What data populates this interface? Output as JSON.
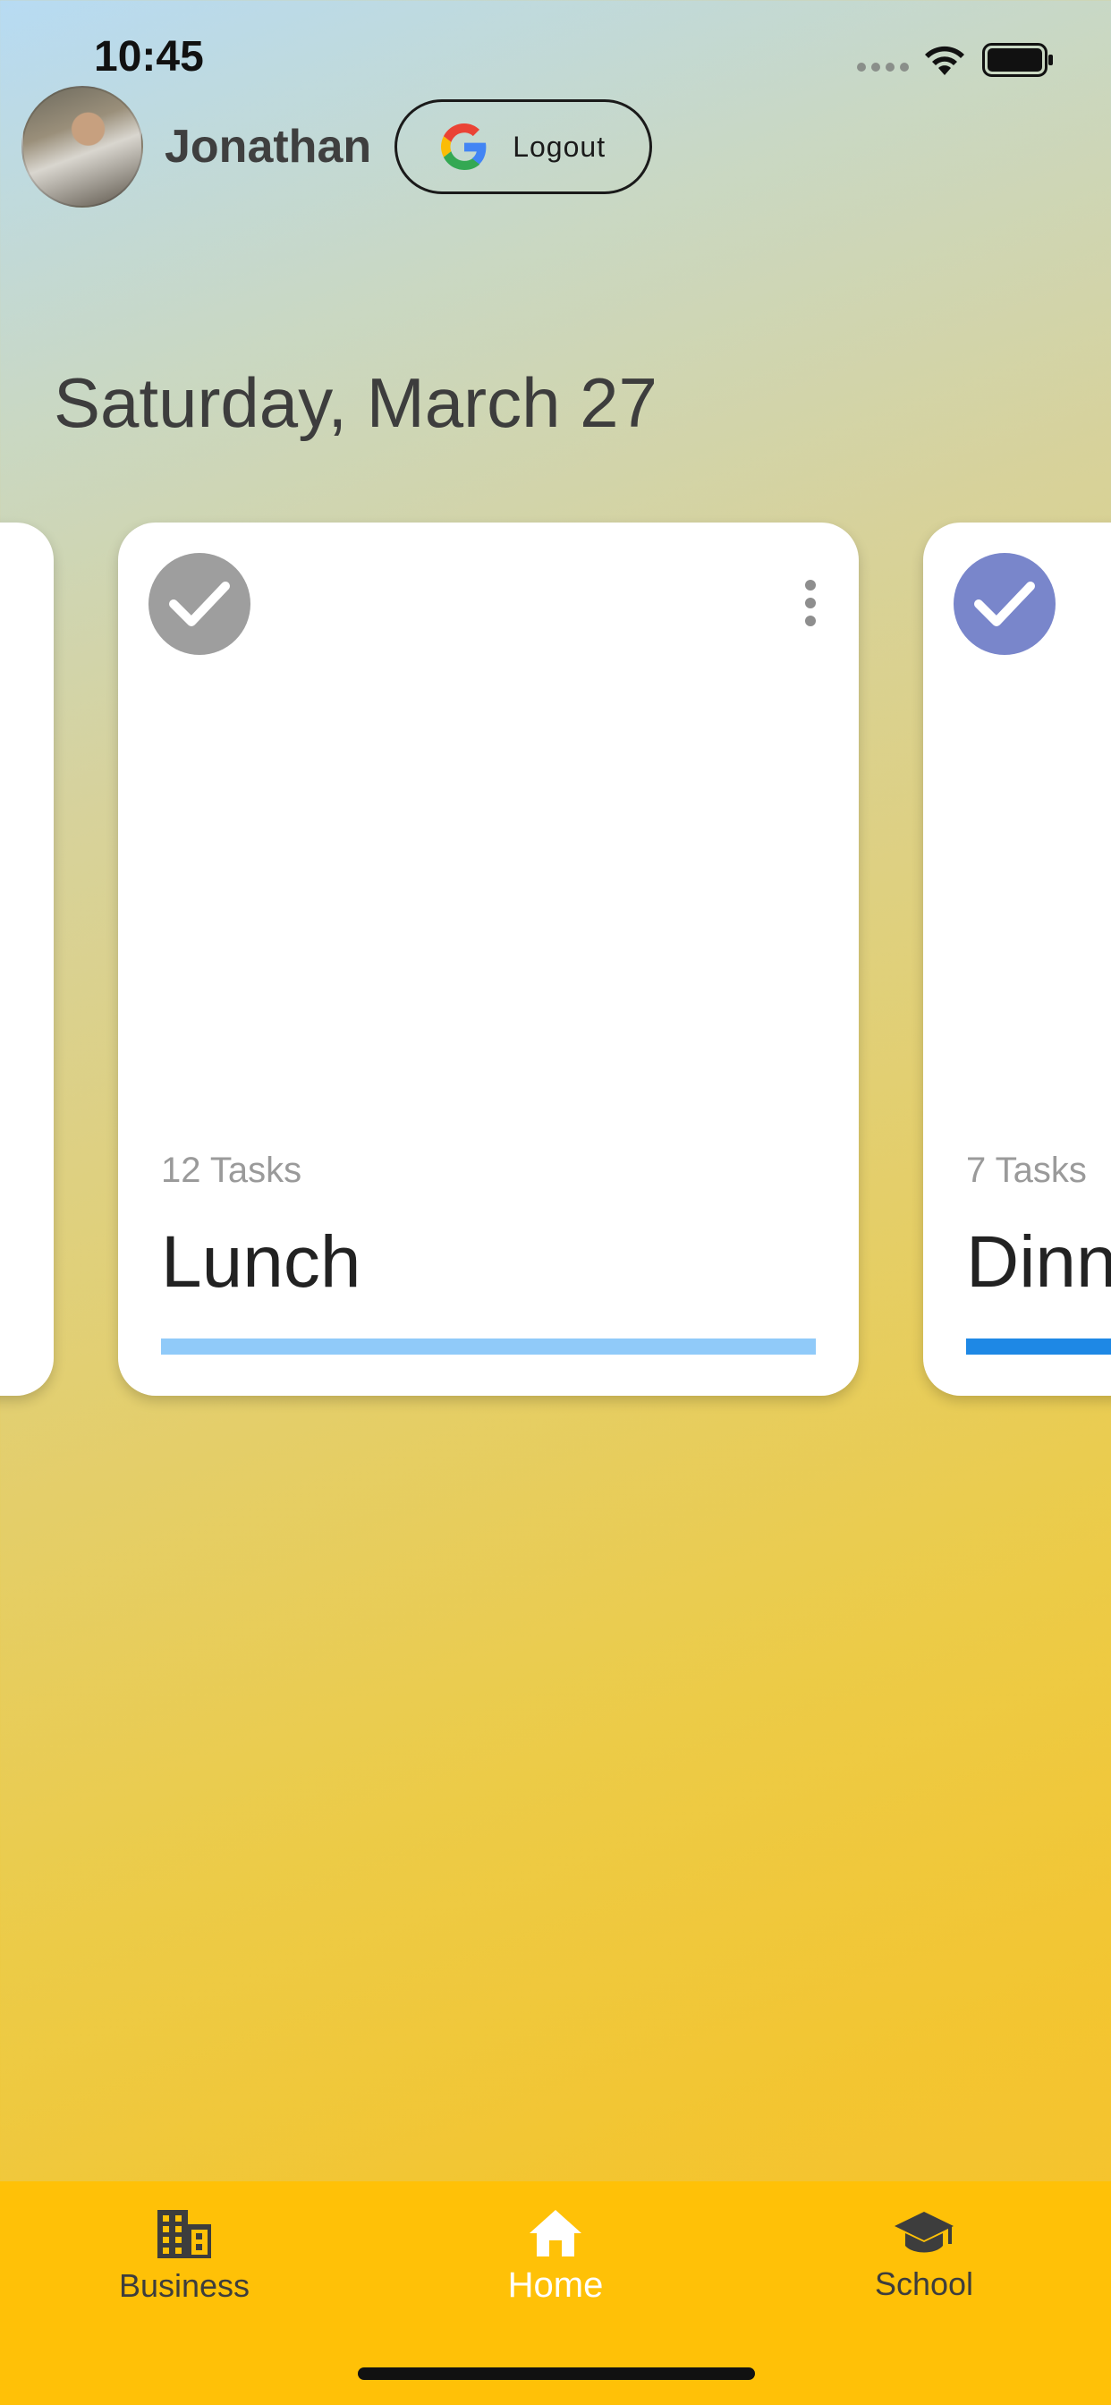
{
  "status_bar": {
    "time": "10:45"
  },
  "header": {
    "user_name": "Jonathan",
    "logout_label": "Logout"
  },
  "date_title": "Saturday, March 27",
  "cards": [
    {
      "task_count": "12 Tasks",
      "title": "Lunch",
      "accent": "#90caf9",
      "check_color": "#9e9e9e",
      "progress": 1.0
    },
    {
      "task_count": "7 Tasks",
      "title": "Dinner",
      "accent": "#1e88e5",
      "check_color": "#7986cb",
      "progress": 1.0
    }
  ],
  "bottom_nav": {
    "items": [
      {
        "label": "Business",
        "icon": "business-icon"
      },
      {
        "label": "Home",
        "icon": "home-icon",
        "selected": true
      },
      {
        "label": "School",
        "icon": "school-icon"
      }
    ],
    "background": "#ffc107"
  }
}
